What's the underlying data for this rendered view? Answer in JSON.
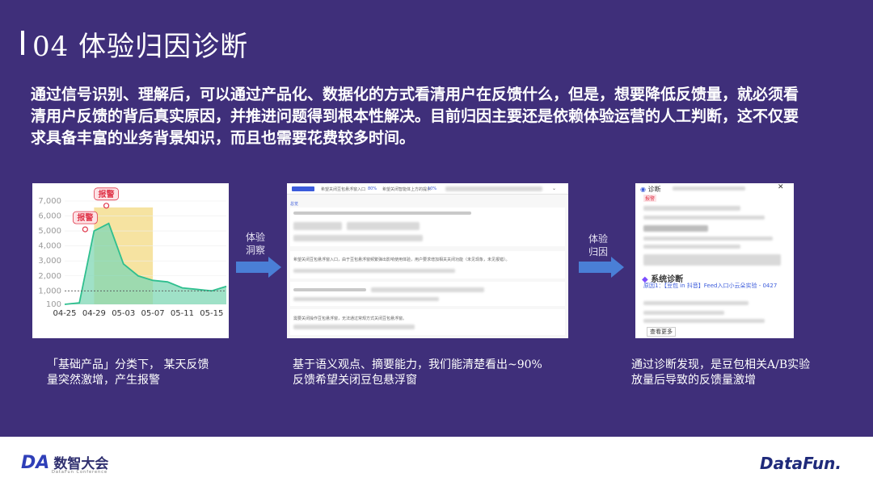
{
  "title": "04 体验归因诊断",
  "intro": "通过信号识别、理解后，可以通过产品化、数据化的方式看清用户在反馈什么，但是，想要降低反馈量，就必须看清用户反馈的背后真实原因，并推进问题得到根本性解决。目前归因主要还是依赖体验运营的人工判断，这不仅要求具备丰富的业务背景知识，而且也需要花费较多时间。",
  "chart_data": {
    "type": "area",
    "x": [
      "04-25",
      "04-27",
      "04-29",
      "05-01",
      "05-03",
      "05-05",
      "05-07",
      "05-09",
      "05-11",
      "05-13",
      "05-15",
      "05-17"
    ],
    "values": [
      100,
      200,
      5000,
      5500,
      2800,
      2000,
      1700,
      1600,
      1200,
      1100,
      1000,
      1300
    ],
    "xticks": [
      "04-25",
      "04-29",
      "05-03",
      "05-07",
      "05-11",
      "05-15"
    ],
    "yticks": [
      "7,000",
      "6,000",
      "5,000",
      "4,000",
      "3,000",
      "2,000",
      "1,000",
      "100"
    ],
    "ylim": [
      100,
      7000
    ],
    "baseline": 1000,
    "alert_labels": [
      "报警",
      "报警"
    ],
    "highlight_range": [
      "04-29",
      "05-07"
    ],
    "colors": {
      "line": "#2fbf8f",
      "fill": "#7fd7b4",
      "highlight": "#f6e3a1",
      "alert": "#e0374b"
    }
  },
  "arrow1": {
    "line1": "体验",
    "line2": "洞察"
  },
  "arrow2": {
    "line1": "体验",
    "line2": "归因"
  },
  "screenshot2": {
    "tab1": "希望关闭豆包悬浮窗入口",
    "tab1_pct": "80%",
    "tab2": "希望关闭智能体上方的提示",
    "tab2_pct": "10%",
    "row1": "希望关闭豆包悬浮窗入口，由于豆包悬浮窗频繁弹出影响使用体验，用户要求增加相关关闭功能（未见现象，未见报错）。",
    "row2": "...",
    "row3": "需要关闭操作豆包悬浮窗，无法通过常规方式关闭豆包悬浮窗。",
    "top_label": "总览"
  },
  "screenshot3": {
    "header": "诊断",
    "badge": "报警",
    "section": "系统诊断",
    "reason": "原因1：【豆包 in 抖音】Feed入口小云朵实验 - 0427",
    "footer": "查看更多"
  },
  "captions": {
    "c1": "「基础产品」分类下， 某天反馈量突然激增，产生报警",
    "c2": "基于语义观点、摘要能力，我们能清楚看出~90%反馈希望关闭豆包悬浮窗",
    "c3": "通过诊断发现，是豆包相关A/B实验放量后导致的反馈量激增"
  },
  "footer": {
    "left_brand": "DA",
    "left_name": "数智大会",
    "left_sub": "DataFun Conference",
    "right_brand": "DataFun."
  },
  "colors": {
    "background": "#3f2f7a",
    "arrow": "#4a7fd6"
  }
}
